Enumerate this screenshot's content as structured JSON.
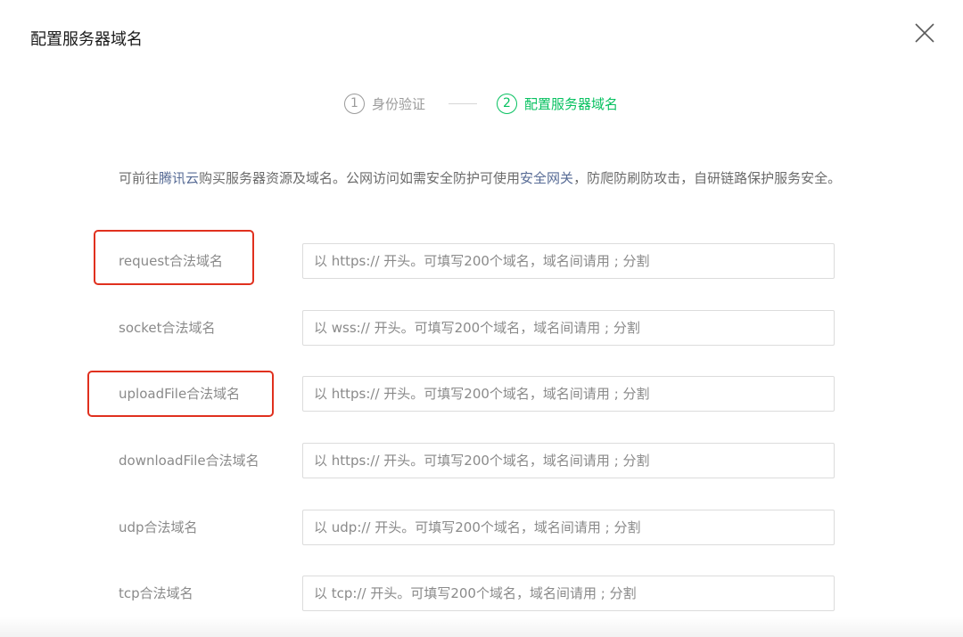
{
  "dialog": {
    "title": "配置服务器域名"
  },
  "steps": [
    {
      "number": "1",
      "label": "身份验证",
      "active": false
    },
    {
      "number": "2",
      "label": "配置服务器域名",
      "active": true
    }
  ],
  "intro": {
    "text_1": "可前往",
    "link_1": "腾讯云",
    "text_2": "购买服务器资源及域名。公网访问如需安全防护可使用",
    "link_2": "安全网关",
    "text_3": "，防爬防刷防攻击，自研链路保护服务安全。"
  },
  "form": {
    "rows": [
      {
        "label": "request合法域名",
        "placeholder": "以 https:// 开头。可填写200个域名，域名间请用 ; 分割",
        "highlighted": true
      },
      {
        "label": "socket合法域名",
        "placeholder": "以 wss:// 开头。可填写200个域名，域名间请用 ; 分割",
        "highlighted": false
      },
      {
        "label": "uploadFile合法域名",
        "placeholder": "以 https:// 开头。可填写200个域名，域名间请用 ; 分割",
        "highlighted": true
      },
      {
        "label": "downloadFile合法域名",
        "placeholder": "以 https:// 开头。可填写200个域名，域名间请用 ; 分割",
        "highlighted": false
      },
      {
        "label": "udp合法域名",
        "placeholder": "以 udp:// 开头。可填写200个域名，域名间请用 ; 分割",
        "highlighted": false
      },
      {
        "label": "tcp合法域名",
        "placeholder": "以 tcp:// 开头。可填写200个域名，域名间请用 ; 分割",
        "highlighted": false
      }
    ]
  },
  "colors": {
    "accent_green": "#07c160",
    "link_blue": "#576b95",
    "highlight_red": "#e0301e"
  },
  "icons": {
    "close": "close-icon"
  }
}
